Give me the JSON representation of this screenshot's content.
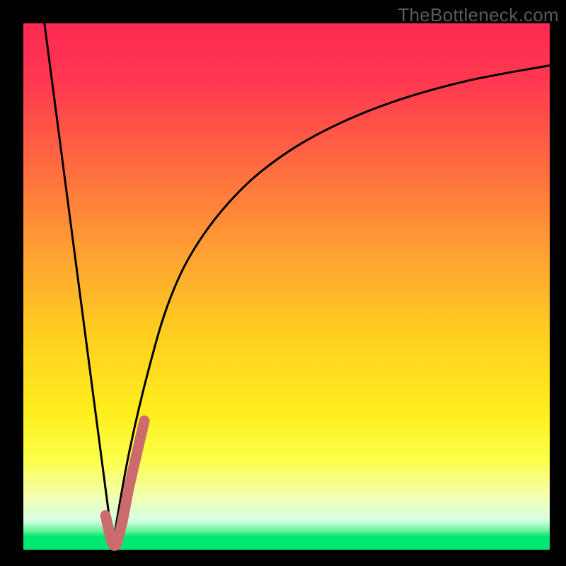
{
  "watermark": "TheBottleneck.com",
  "colors": {
    "frame": "#000000",
    "curve_primary": "#000000",
    "curve_highlight": "#cc6b6e",
    "gradient_stops": [
      {
        "offset": 0.0,
        "color": "#ff2853"
      },
      {
        "offset": 0.12,
        "color": "#ff3b4f"
      },
      {
        "offset": 0.28,
        "color": "#ff6e3f"
      },
      {
        "offset": 0.45,
        "color": "#ffa531"
      },
      {
        "offset": 0.6,
        "color": "#ffd11f"
      },
      {
        "offset": 0.74,
        "color": "#ffee1e"
      },
      {
        "offset": 0.83,
        "color": "#fcff4a"
      },
      {
        "offset": 0.9,
        "color": "#f3ffb3"
      },
      {
        "offset": 0.945,
        "color": "#d6ffe5"
      },
      {
        "offset": 0.965,
        "color": "#63f29a"
      },
      {
        "offset": 0.975,
        "color": "#00e772"
      },
      {
        "offset": 1.0,
        "color": "#00e772"
      }
    ]
  },
  "chart_data": {
    "type": "line",
    "title": "",
    "xlabel": "",
    "ylabel": "",
    "xlim": [
      0,
      100
    ],
    "ylim": [
      0,
      100
    ],
    "series": [
      {
        "name": "left-descending-line",
        "x": [
          4,
          17
        ],
        "values": [
          100,
          1
        ]
      },
      {
        "name": "right-log-curve",
        "x": [
          17,
          20,
          24,
          28,
          33,
          40,
          48,
          58,
          70,
          84,
          100
        ],
        "values": [
          1,
          18,
          35,
          48,
          58,
          67,
          74,
          80,
          85,
          89,
          92
        ]
      },
      {
        "name": "highlight-segment",
        "x": [
          15.6,
          17.2,
          18.6,
          20.0,
          21.6,
          23.0
        ],
        "values": [
          6.5,
          0.8,
          4.5,
          11.5,
          18.5,
          24.5
        ]
      }
    ]
  }
}
